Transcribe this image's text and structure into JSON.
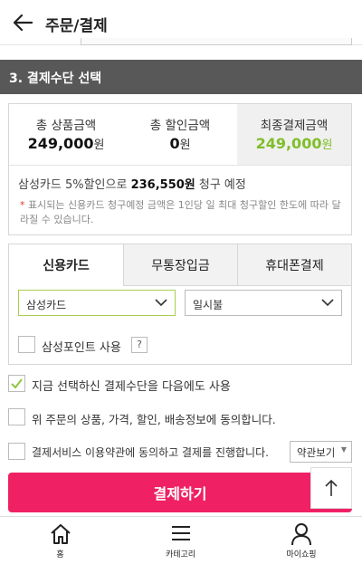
{
  "header": {
    "title": "주문/결제"
  },
  "section": {
    "title": "3. 결제수단 선택"
  },
  "summary": {
    "total_products_label": "총 상품금액",
    "total_products_value": "249,000",
    "total_discount_label": "총 할인금액",
    "total_discount_value": "0",
    "final_label": "최종결제금액",
    "final_value": "249,000",
    "currency": "원",
    "expected_prefix": "삼성카드 5%할인으로 ",
    "expected_amount": "236,550원",
    "expected_suffix": " 청구 예정",
    "note_star": "*",
    "note": "표시되는 신용카드 청구예정 금액은 1인당 일 최대 청구할인 한도에 따라 달라질 수 있습니다.",
    "final_color": "#7fbe2a"
  },
  "payment": {
    "tabs": [
      "신용카드",
      "무통장입금",
      "휴대폰결제"
    ],
    "active_tab": "신용카드",
    "card_select": "삼성카드",
    "installment_select": "일시불",
    "points_label": "삼성포인트 사용",
    "points_help": "?"
  },
  "options": {
    "save_method_label": "지금 선택하신 결제수단을 다음에도 사용",
    "save_method_checked": true,
    "agree_order_label": "위 주문의 상품, 가격, 할인, 배송정보에 동의합니다.",
    "agree_terms_label": "결제서비스 이용약관에 동의하고 결제를 진행합니다.",
    "terms_view_label": "약관보기"
  },
  "actions": {
    "pay_label": "결제하기",
    "pay_color": "#ef2164"
  },
  "bottom_nav": {
    "home": "홈",
    "category": "카테고리",
    "my": "마이쇼핑"
  }
}
